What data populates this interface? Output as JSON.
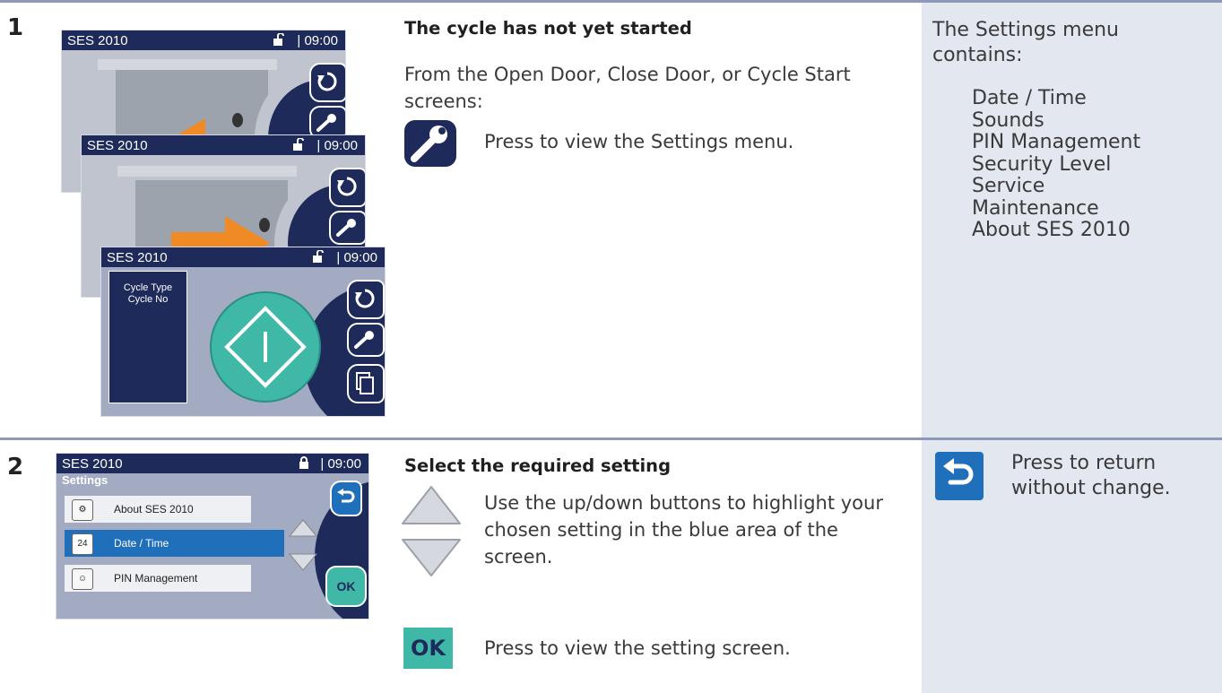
{
  "step1": {
    "number": "1",
    "heading": "The cycle has not yet started",
    "text": "From the Open Door, Close Door, or Cycle Start screens:",
    "settings_button_text": "Press to view the Settings menu.",
    "side_intro": "The Settings menu contains:",
    "menu_items": [
      "Date / Time",
      "Sounds",
      "PIN Management",
      "Security Level",
      "Service",
      "Maintenance",
      "About SES 2010"
    ],
    "screens": {
      "title": "SES 2010",
      "time": "09:00",
      "separator": "|",
      "cycle_type": "Cycle Type",
      "cycle_no": "Cycle No"
    }
  },
  "step2": {
    "number": "2",
    "heading": "Select the required setting",
    "updown_text": "Use the up/down buttons to highlight your chosen setting in the blue area of the screen.",
    "ok_label": "OK",
    "ok_text": "Press to view the setting screen.",
    "back_text": "Press to return without change.",
    "screen": {
      "title": "SES 2010",
      "time": "09:00",
      "separator": "|",
      "section": "Settings",
      "rows": [
        "About SES 2010",
        "Date / Time",
        "PIN Management"
      ],
      "calendar_day": "24",
      "ok_button": "OK"
    }
  },
  "colors": {
    "navy": "#1d2a5a",
    "highlight_blue": "#1f6fba",
    "teal": "#3fb8a8",
    "orange": "#f08a24",
    "sidebar": "#e3e7f0"
  }
}
